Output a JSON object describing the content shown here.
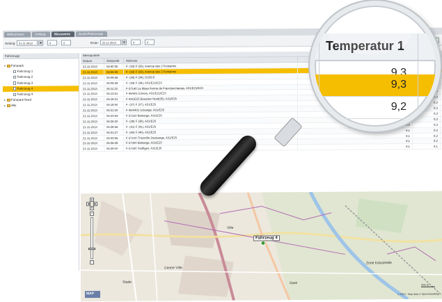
{
  "tabs": [
    "Willkommen",
    "Umlang",
    "Messwerte",
    "Archiv/Fahrzeuge"
  ],
  "active_tab_index": 2,
  "toolbar": {
    "from_label": "Anfang:",
    "from_date": "21.11.2013",
    "from_hour": "0",
    "from_min": "0",
    "to_label": "Ende:",
    "to_date": "22.11.2013",
    "to_hour": "0",
    "to_min": "0"
  },
  "left_panel": {
    "title": "Fahrzeuge",
    "items": [
      {
        "label": "Fuhrpark",
        "type": "folder",
        "level": 0
      },
      {
        "label": "Fahrzeug 1",
        "type": "leaf",
        "level": 1
      },
      {
        "label": "Fahrzeug 2",
        "type": "leaf",
        "level": 1
      },
      {
        "label": "Fahrzeug 3",
        "type": "leaf",
        "level": 1
      },
      {
        "label": "Fahrzeug 4",
        "type": "leaf",
        "level": 1,
        "selected": true
      },
      {
        "label": "Fahrzeug 4",
        "type": "leaf",
        "level": 1
      },
      {
        "label": "Fuhrpark Nord",
        "type": "folder",
        "level": 0
      },
      {
        "label": "Alle",
        "type": "folder",
        "level": 0
      }
    ]
  },
  "table": {
    "title": "Messpunkte",
    "columns": [
      "Datum",
      "Zeitpunkt",
      "Adresse",
      "",
      "ret"
    ],
    "rows": [
      [
        "21.11.2013",
        "04:40:35",
        "F- (33) F (33), Avenue des 2 Fontaines",
        "",
        "8,4"
      ],
      [
        "21.11.2013",
        "04:55:45",
        "F- (33) F (33), Avenue des 2 Fontaines",
        "",
        "8,4"
      ],
      [
        "21.11.2013",
        "05:08:46",
        "F- (34) F (34), D155 B",
        "",
        "8,3"
      ],
      [
        "21.11.2013",
        "05:08:49",
        "F- (34) F (34), A31/E21/E23",
        "",
        "8,3"
      ],
      [
        "21.11.2013",
        "05:11:22",
        "F-57140 La Maxe Ferme de Franclonchamps, A31/E21/E23",
        "",
        "8,3"
      ],
      [
        "21.11.2013",
        "05:13:51",
        "F-46/431 Ennery, A31/E21/E23",
        "",
        "8,3"
      ],
      [
        "21.11.2013",
        "05:16:21",
        "F-431/E25 Boussier Nord(35), A31/E25",
        "",
        "8,3"
      ],
      [
        "21.11.2013",
        "05:18:50",
        "F- (37) F (37), A31/E25",
        "",
        "8,3"
      ],
      [
        "21.11.2013",
        "05:21:20",
        "F-450/431 Uckange, A31/E25",
        "",
        "8,3"
      ],
      [
        "21.11.2013",
        "05:23:54",
        "F-57310 Bettange, A31/E25",
        "9,2",
        "8,3"
      ],
      [
        "21.11.2013",
        "05:26:20",
        "F- (38) F (38), A31/E25",
        "9,1",
        "8,3"
      ],
      [
        "21.11.2013",
        "05:28:56",
        "F- (41) F (41), A31/E25",
        "9,0",
        "8,3"
      ],
      [
        "21.11.2013",
        "05:31:27",
        "F- (40) F (40), A31/E25",
        "9,1",
        "8,3"
      ],
      [
        "21.11.2013",
        "05:33:56",
        "F-57100 Thionville Deubange, A31/E25",
        "9,1",
        "8,2"
      ],
      [
        "21.11.2013",
        "05:36:28",
        "F-57300 Bettange, A31/E25",
        "9,1",
        "8,2"
      ],
      [
        "21.11.2013",
        "05:39:00",
        "F-57330 Stuffigen, A31/E25",
        "9,1",
        "8,1"
      ]
    ],
    "selected_row_index": 1
  },
  "map": {
    "marker_label": "Fahrzeug 4",
    "logo": "MAP",
    "scale": "200 m",
    "copyright": "© 2013 - Map data © OpenStreetMap",
    "labels": [
      "Ville",
      "Centre Ville",
      "Stade",
      "Gare",
      "Zone Industrielle"
    ]
  },
  "magnifier": {
    "column_title": "Temperatur 1",
    "values": [
      "9,3",
      "9,3",
      "9,2"
    ],
    "selected_index": 1,
    "colors": {
      "highlight": "#f6be00",
      "header_bg": "#eef1f4"
    }
  }
}
